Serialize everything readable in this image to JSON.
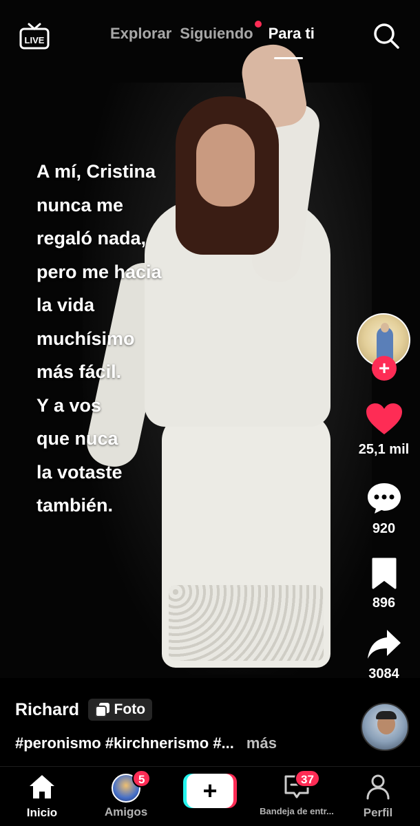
{
  "topbar": {
    "live_label": "LIVE",
    "tabs": [
      {
        "label": "Explorar",
        "active": false
      },
      {
        "label": "Siguiendo",
        "active": false,
        "has_dot": true
      },
      {
        "label": "Para ti",
        "active": true
      }
    ]
  },
  "post": {
    "overlay_text": "A mí, Cristina\nnunca me\nregaló nada,\npero me hacia\nla vida\nmuchísimo\nmás fácil.\nY a vos\nque nuca\nla votaste\ntambién.",
    "author": "Richard",
    "type_badge": "Foto",
    "hashtags": "#peronismo #kirchnerismo #...",
    "more_label": "más"
  },
  "rail": {
    "likes": "25,1 mil",
    "comments": "920",
    "saves": "896",
    "shares": "3084"
  },
  "bottomnav": {
    "items": [
      {
        "label": "Inicio",
        "active": true
      },
      {
        "label": "Amigos",
        "badge": "5"
      },
      {
        "label": "",
        "icon": "plus-icon"
      },
      {
        "label": "Bandeja de entr...",
        "badge": "37"
      },
      {
        "label": "Perfil"
      }
    ]
  },
  "colors": {
    "accent": "#fe2c55",
    "cyan": "#25f4ee"
  }
}
